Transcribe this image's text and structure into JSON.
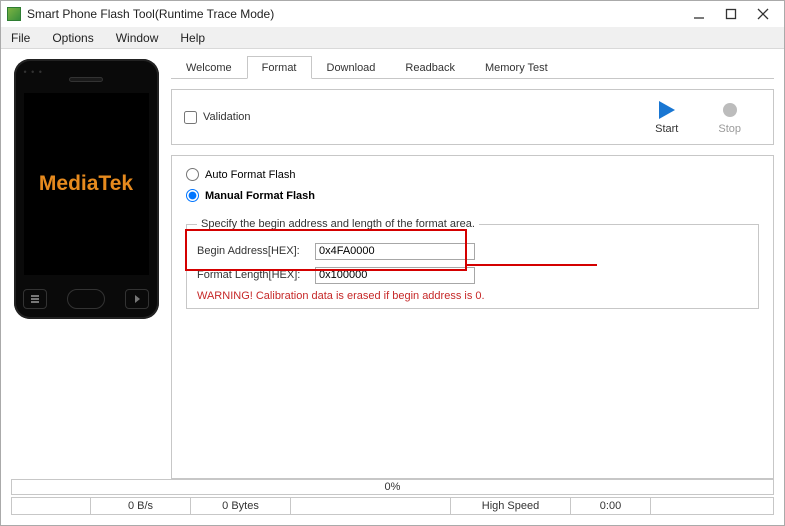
{
  "window": {
    "title": "Smart Phone Flash Tool(Runtime Trace Mode)"
  },
  "menu": {
    "file": "File",
    "options": "Options",
    "window": "Window",
    "help": "Help"
  },
  "phone": {
    "brand": "MediaTek"
  },
  "tabs": {
    "welcome": "Welcome",
    "format": "Format",
    "download": "Download",
    "readback": "Readback",
    "memory_test": "Memory Test"
  },
  "actionbar": {
    "validation_label": "Validation",
    "start_label": "Start",
    "stop_label": "Stop"
  },
  "format": {
    "auto_label": "Auto Format Flash",
    "manual_label": "Manual Format Flash",
    "legend": "Specify the begin address and length of the format area.",
    "begin_label": "Begin Address[HEX]:",
    "begin_value": "0x4FA0000",
    "length_label": "Format Length[HEX]:",
    "length_value": "0x100000",
    "warning": "WARNING! Calibration data is erased if begin address is 0."
  },
  "status": {
    "percent": "0%",
    "rate": "0 B/s",
    "bytes": "0 Bytes",
    "mode": "High Speed",
    "time": "0:00"
  }
}
